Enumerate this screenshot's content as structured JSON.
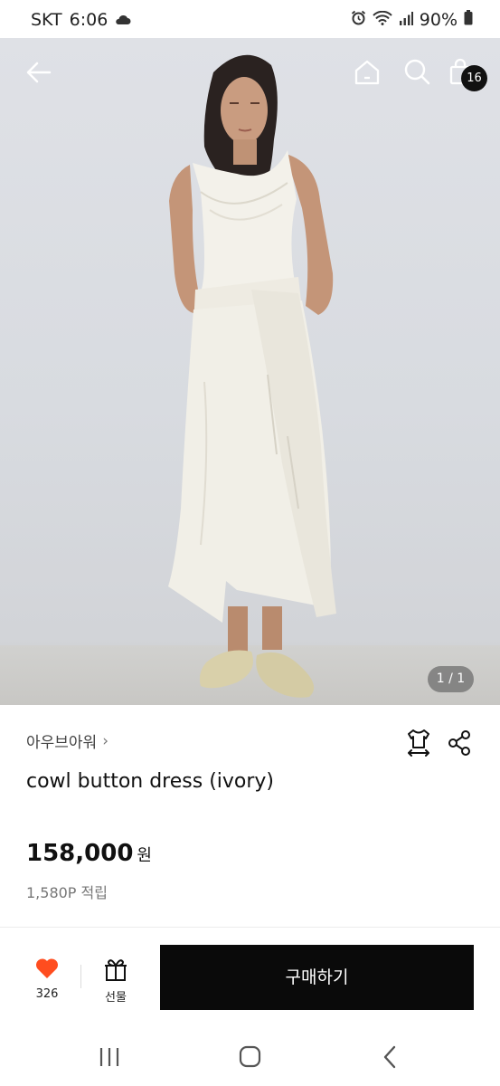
{
  "status_bar": {
    "carrier": "SKT",
    "time": "6:06",
    "battery": "90%"
  },
  "top_nav": {
    "cart_count": "16"
  },
  "image_pager": "1 / 1",
  "product": {
    "brand": "아우브아워",
    "brand_chevron": "›",
    "name": "cowl button dress (ivory)",
    "price": "158,000",
    "price_unit": "원",
    "points": "1,580P 적립"
  },
  "actions": {
    "like_count": "326",
    "gift_label": "선물",
    "buy_label": "구매하기"
  },
  "colors": {
    "like_heart": "#ff4d1f",
    "buy_button": "#0a0a0a",
    "badge": "#111111"
  },
  "icons": [
    "cloud-icon",
    "alarm-icon",
    "wifi-icon",
    "signal-icon",
    "battery-icon",
    "back-arrow-icon",
    "home-icon",
    "search-icon",
    "shopping-bag-icon",
    "size-guide-icon",
    "share-icon",
    "heart-icon",
    "gift-icon",
    "recent-apps-icon",
    "home-button-icon",
    "android-back-icon"
  ]
}
